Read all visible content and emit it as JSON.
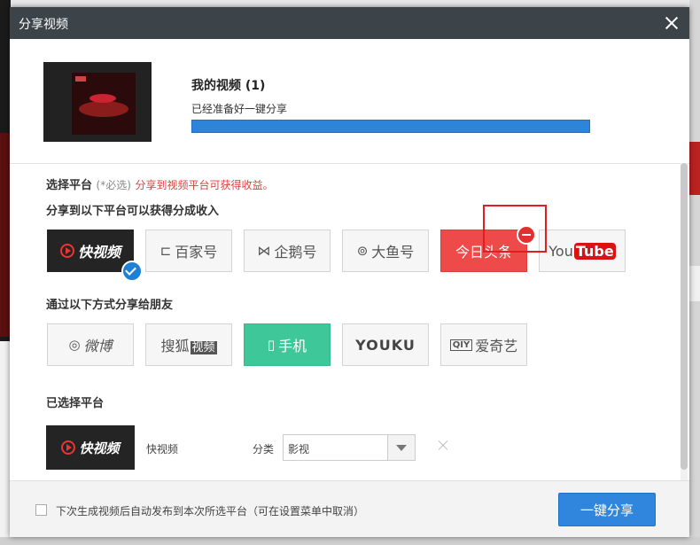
{
  "dialog": {
    "title": "分享视频"
  },
  "video": {
    "title": "我的视频 (1)",
    "status": "已经准备好一键分享",
    "progress": 1.0
  },
  "platform_section": {
    "title": "选择平台",
    "required": "(*必选)",
    "tip": "分享到视频平台可获得收益。"
  },
  "revenue_section": {
    "title": "分享到以下平台可以获得分成收入",
    "platforms": [
      {
        "label": "快视频",
        "icon": "kuaishipin-play-icon",
        "selected": true
      },
      {
        "label": "百家号",
        "icon": "baijiahao-icon"
      },
      {
        "label": "企鹅号",
        "icon": "penguin-icon"
      },
      {
        "label": "大鱼号",
        "icon": "fish-icon"
      },
      {
        "label": "今日头条",
        "icon": "minus-circle-icon"
      },
      {
        "label": "You",
        "label2": "Tube",
        "icon": "youtube-icon"
      }
    ]
  },
  "friends_section": {
    "title": "通过以下方式分享给朋友",
    "platforms": [
      {
        "label": "微博",
        "icon": "weibo-icon"
      },
      {
        "label": "搜狐",
        "label2": "视频",
        "icon": "sohu-icon"
      },
      {
        "label": "手机",
        "icon": "phone-icon"
      },
      {
        "label": "YOUKU",
        "icon": "youku-icon"
      },
      {
        "label": "爱奇艺",
        "badge": "QIY",
        "icon": "iqiyi-icon"
      }
    ]
  },
  "selected_section": {
    "title": "已选择平台",
    "items": [
      {
        "thumb_label": "快视频",
        "name": "快视频",
        "category_label": "分类",
        "category_value": "影视"
      }
    ]
  },
  "footer": {
    "auto_publish_label": "下次生成视频后自动发布到本次所选平台（可在设置菜单中取消）",
    "auto_publish_checked": false,
    "share_button": "一键分享"
  },
  "colors": {
    "titlebar": "#3d4449",
    "accent": "#2f86dc",
    "toutiao": "#ee4a4a",
    "phone": "#3ec89a",
    "tip": "#e04040"
  }
}
